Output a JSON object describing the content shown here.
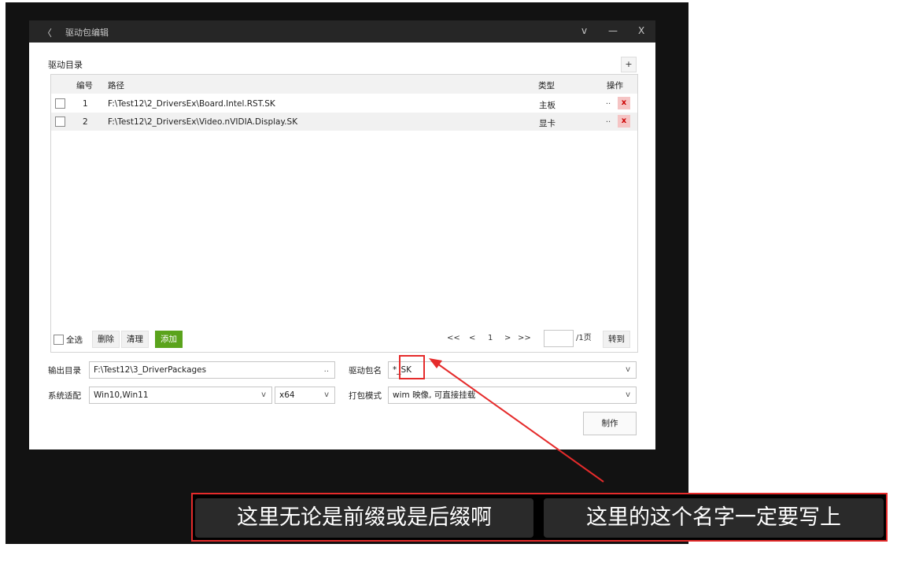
{
  "window": {
    "back_glyph": "〈",
    "title": "驱动包编辑",
    "controls": [
      "v",
      "—",
      "X"
    ]
  },
  "driver_dir": {
    "section_label": "驱动目录",
    "add_glyph": "+",
    "columns": [
      "编号",
      "路径",
      "类型",
      "操作"
    ],
    "rows": [
      {
        "no": "1",
        "path": "F:\\Test12\\2_DriversEx\\Board.Intel.RST.SK",
        "type": "主板",
        "dots": "..",
        "x": "x"
      },
      {
        "no": "2",
        "path": "F:\\Test12\\2_DriversEx\\Video.nVIDIA.Display.SK",
        "type": "显卡",
        "dots": "..",
        "x": "x"
      }
    ]
  },
  "bottom": {
    "select_all": "全选",
    "delete": "删除",
    "clear": "清理",
    "add": "添加",
    "pager": {
      "first": "<<",
      "prev": "<",
      "page": "1",
      "next": ">",
      "last": ">>",
      "page_input": "",
      "total": "/1页",
      "goto": "转到"
    }
  },
  "form": {
    "output_label": "输出目录",
    "output_value": "F:\\Test12\\3_DriverPackages",
    "output_browse": "..",
    "pkgname_label": "驱动包名",
    "pkgname_value": "*_SK",
    "system_label": "系统适配",
    "system_value": "Win10,Win11",
    "arch_value": "x64",
    "packmode_label": "打包模式",
    "packmode_value": "wim 映像, 可直接挂载",
    "chevron": "v",
    "make": "制作"
  },
  "annotation": {
    "color": "#e52b2b"
  },
  "subtitles": {
    "left": "这里无论是前缀或是后缀啊",
    "right": "这里的这个名字一定要写上"
  }
}
